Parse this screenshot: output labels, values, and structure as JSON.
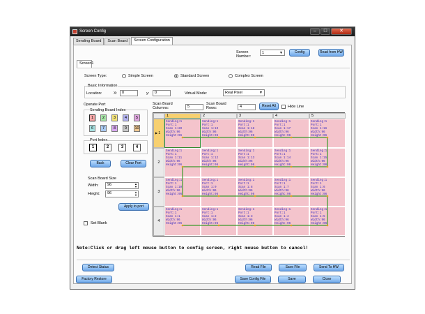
{
  "window": {
    "title": "Screen Config"
  },
  "tabs": [
    "Sending Board",
    "Scan Board",
    "Screen Configuration"
  ],
  "inner_tab": "Screen1",
  "screen_number": {
    "label": "Screen Number:",
    "value": "1"
  },
  "buttons_top": {
    "config": "Config",
    "read_from_hw": "Read from HW"
  },
  "screen_type": {
    "label": "Screen Type:",
    "options": [
      "Simple Screen",
      "Standard Screen",
      "Complex Screen"
    ],
    "selected": "Standard Screen"
  },
  "basic_info": {
    "label": "Basic Information",
    "location": "Location:",
    "x_label": "X:",
    "x_value": "0",
    "y_label": "y:",
    "y_value": "0",
    "virtual_mode_label": "Virtual Mode:",
    "virtual_mode_value": "Real Pixel"
  },
  "operate_port": {
    "label": "Operate Port",
    "sending_board_index_label": "Sending Board Index",
    "sending_boards": [
      {
        "n": "1",
        "color": "#f7a8a8"
      },
      {
        "n": "2",
        "color": "#a6e3a6"
      },
      {
        "n": "3",
        "color": "#f2e27a"
      },
      {
        "n": "4",
        "color": "#b3b3f0"
      },
      {
        "n": "5",
        "color": "#e0a6e0"
      },
      {
        "n": "6",
        "color": "#a6e0e0"
      },
      {
        "n": "7",
        "color": "#a8c8f0"
      },
      {
        "n": "8",
        "color": "#d8a8f0"
      },
      {
        "n": "9",
        "color": "#c8c8c8"
      },
      {
        "n": "10",
        "color": "#f0c890"
      }
    ],
    "port_index_label": "Port Index",
    "ports": [
      "1",
      "2",
      "3",
      "4"
    ],
    "back": "Back",
    "clear_port": "Clear Port"
  },
  "scan_board_size": {
    "label": "Scan Board Size",
    "width_label": "Width:",
    "width": "96",
    "height_label": "Height:",
    "height": "96",
    "apply": "Apply to port"
  },
  "set_blank": "Set Blank",
  "scan_board_columns": {
    "label": "Scan Board Columns:",
    "value": "5"
  },
  "scan_board_rows": {
    "label": "Scan Board Rows:",
    "value": "4"
  },
  "reset_all": "Reset All",
  "hide_line": "Hide Line",
  "grid": {
    "columns": [
      "1",
      "2",
      "3",
      "4",
      "5"
    ],
    "rows": [
      "1",
      "2",
      "3",
      "4"
    ],
    "cells": [
      [
        [
          "Sending:1",
          "Port:1",
          "Scan 1:20",
          "Width:96",
          "Height:96"
        ],
        [
          "Sending:1",
          "Port:1",
          "Scan 1:19",
          "Width:96",
          "Height:96"
        ],
        [
          "Sending:1",
          "Port:1",
          "Scan 1:18",
          "Width:96",
          "Height:96"
        ],
        [
          "Sending:1",
          "Port:1",
          "Scan 1:17",
          "Width:96",
          "Height:96"
        ],
        [
          "Sending:1",
          "Port:1",
          "Scan 1:16",
          "Width:96",
          "Height:96"
        ]
      ],
      [
        [
          "Sending:1",
          "Port:1",
          "Scan 1:11",
          "Width:96",
          "Height:96"
        ],
        [
          "Sending:1",
          "Port:1",
          "Scan 1:12",
          "Width:96",
          "Height:96"
        ],
        [
          "Sending:1",
          "Port:1",
          "Scan 1:13",
          "Width:96",
          "Height:96"
        ],
        [
          "Sending:1",
          "Port:1",
          "Scan 1:14",
          "Width:96",
          "Height:96"
        ],
        [
          "Sending:1",
          "Port:1",
          "Scan 1:15",
          "Width:96",
          "Height:96"
        ]
      ],
      [
        [
          "Sending:1",
          "Port:1",
          "Scan 1:10",
          "Width:96",
          "Height:96"
        ],
        [
          "Sending:1",
          "Port:1",
          "Scan 1:9",
          "Width:96",
          "Height:96"
        ],
        [
          "Sending:1",
          "Port:1",
          "Scan 1:8",
          "Width:96",
          "Height:96"
        ],
        [
          "Sending:1",
          "Port:1",
          "Scan 1:7",
          "Width:96",
          "Height:96"
        ],
        [
          "Sending:1",
          "Port:1",
          "Scan 1:6",
          "Width:96",
          "Height:96"
        ]
      ],
      [
        [
          "Sending:1",
          "Port:1",
          "Scan 1:1",
          "Width:96",
          "Height:96"
        ],
        [
          "Sending:1",
          "Port:1",
          "Scan 1:2",
          "Width:96",
          "Height:96"
        ],
        [
          "Sending:1",
          "Port:1",
          "Scan 1:3",
          "Width:96",
          "Height:96"
        ],
        [
          "Sending:1",
          "Port:1",
          "Scan 1:4",
          "Width:96",
          "Height:96"
        ],
        [
          "Sending:1",
          "Port:1",
          "Scan 1:5",
          "Width:96",
          "Height:96"
        ]
      ]
    ]
  },
  "note": "Note:Click or drag left mouse button to config screen, right mouse button to cancel!",
  "bottom_buttons": {
    "detect_status": "Detect Status",
    "read_file": "Read File",
    "save_file": "Save File",
    "send_to_hw": "Send To HW",
    "factory_restore": "Factory Restore",
    "save_config_file": "Save Config File",
    "save": "Save",
    "close": "Close"
  },
  "colors": {
    "cell_bg": "#f4c4cc",
    "cell_text": "#3a2cc0",
    "route": "#3a9a2a",
    "button_blue": "#6fa7e8"
  }
}
